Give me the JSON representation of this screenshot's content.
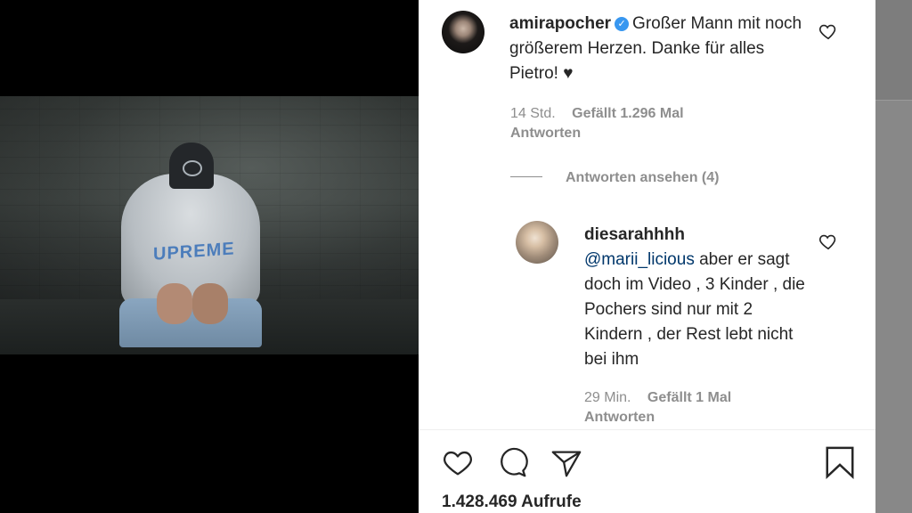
{
  "caption": {
    "username": "amirapocher",
    "text": "Großer Mann mit noch größerem Herzen. Danke für alles Pietro! ♥",
    "time": "14 Std.",
    "likes": "Gefällt 1.296 Mal",
    "reply_label": "Antworten"
  },
  "view_replies": "Antworten ansehen (4)",
  "reply": {
    "username": "diesarahhhh",
    "mention": "@marii_licious",
    "text": " aber er sagt doch im Video , 3 Kinder , die Pochers sind nur mit 2 Kindern , der Rest lebt nicht bei ihm",
    "time": "29 Min.",
    "likes": "Gefällt 1 Mal",
    "reply_label": "Antworten"
  },
  "video_overlay_text": "UPREME",
  "views": "1.428.469 Aufrufe",
  "icons": [
    "heart-icon",
    "comment-icon",
    "share-icon",
    "bookmark-icon",
    "verified-icon"
  ],
  "colors": {
    "verified": "#3897f0",
    "meta": "#8e8e8e",
    "text": "#262626",
    "mention": "#00376b"
  }
}
